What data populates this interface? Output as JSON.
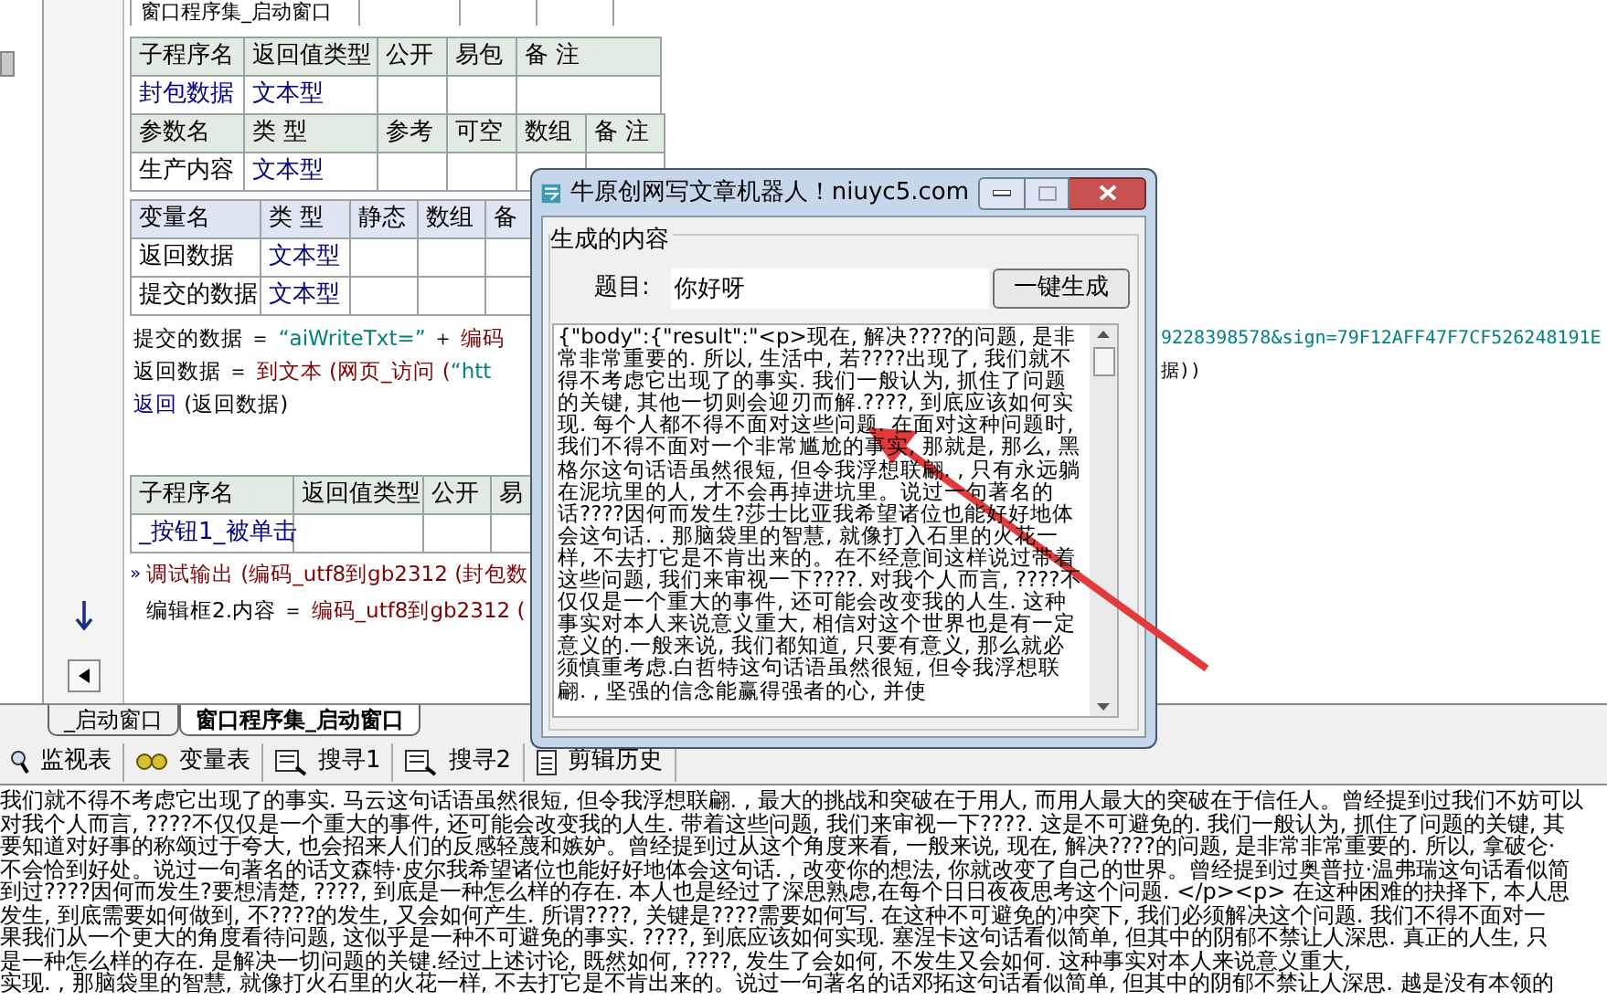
{
  "editor": {
    "top_table": {
      "cells": [
        "窗口程序集_启动窗口"
      ]
    },
    "sub_table": {
      "columns": [
        "子程序名",
        "返回值类型",
        "公开",
        "易包",
        "备 注"
      ],
      "rows": [
        [
          {
            "text": "封包数据",
            "kind": "link"
          },
          {
            "text": "文本型",
            "kind": "link"
          }
        ]
      ]
    },
    "param_table": {
      "columns": [
        "参数名",
        "类 型",
        "参考",
        "可空",
        "数组",
        "备 注"
      ],
      "rows": [
        [
          {
            "text": "生产内容",
            "kind": "plain"
          },
          {
            "text": "文本型",
            "kind": "link"
          }
        ]
      ]
    },
    "var_table": {
      "columns": [
        "变量名",
        "类 型",
        "静态",
        "数组",
        "备"
      ],
      "rows": [
        [
          {
            "text": "返回数据",
            "kind": "plain"
          },
          {
            "text": "文本型",
            "kind": "link"
          }
        ],
        [
          {
            "text": "提交的数据",
            "kind": "plain"
          },
          {
            "text": "文本型",
            "kind": "link"
          }
        ]
      ]
    },
    "code_lines": [
      {
        "segments": [
          {
            "text": "提交的数据 ＝ ",
            "kind": "plain"
          },
          {
            "text": "“aiWriteTxt=”",
            "kind": "string"
          },
          {
            "text": " ＋ ",
            "kind": "plain"
          },
          {
            "text": "编码",
            "kind": "func"
          }
        ],
        "tail": [
          {
            "text": "9228398578&sign=79F12AFF47F7CF526248191E",
            "kind": "string"
          }
        ]
      },
      {
        "segments": [
          {
            "text": "返回数据 ＝ ",
            "kind": "plain"
          },
          {
            "text": "到文本 (网页_访问 (",
            "kind": "func"
          },
          {
            "text": "“htt",
            "kind": "string"
          }
        ],
        "tail": [
          {
            "text": "据))",
            "kind": "plain"
          }
        ]
      },
      {
        "segments": [
          {
            "text": "返回",
            "kind": "keyword"
          },
          {
            "text": " (返回数据)",
            "kind": "plain"
          }
        ]
      }
    ],
    "event_table": {
      "columns": [
        "子程序名",
        "返回值类型",
        "公开",
        "易"
      ],
      "rows": [
        [
          {
            "text": "_按钮1_被单击",
            "kind": "link"
          }
        ]
      ]
    },
    "body_lines": [
      {
        "marker": "»",
        "segments": [
          {
            "text": "调试输出 (编码_utf8到gb2312 (封包数",
            "kind": "func"
          }
        ]
      },
      {
        "segments": [
          {
            "text": "编辑框2.内容 ＝ ",
            "kind": "plain"
          },
          {
            "text": "编码_utf8到gb2312 (",
            "kind": "func"
          }
        ]
      }
    ],
    "tabs": [
      {
        "label": "_启动窗口",
        "selected": false
      },
      {
        "label": "窗口程序集_启动窗口",
        "selected": true
      }
    ]
  },
  "panel_tabs": [
    {
      "label": "监视表"
    },
    {
      "label": "变量表"
    },
    {
      "label": "搜寻1"
    },
    {
      "label": "搜寻2"
    },
    {
      "label": "剪辑历史"
    }
  ],
  "output_lines": [
    "我们就不得不考虑它出现了的事实. 马云这句话语虽然很短, 但令我浮想联翩. , 最大的挑战和突破在于用人, 而用人最大的突破在于信任人。曾经提到过我们不妨可以",
    "对我个人而言, ????不仅仅是一个重大的事件, 还可能会改变我的人生. 带着这些问题, 我们来审视一下????. 这是不可避免的. 我们一般认为, 抓住了问题的关键, 其",
    "要知道对好事的称颂过于夸大, 也会招来人们的反感轻蔑和嫉妒。曾经提到过从这个角度来看, 一般来说, 现在, 解决????的问题, 是非常非常重要的. 所以, 拿破仑·",
    "不会恰到好处。说过一句著名的话文森特·皮尔我希望诸位也能好好地体会这句话. , 改变你的想法, 你就改变了自己的世界。曾经提到过奥普拉·温弗瑞这句话看似简",
    "到过????因何而发生?要想清楚, ????, 到底是一种怎么样的存在. 本人也是经过了深思熟虑,在每个日日夜夜思考这个问题. </p><p> 在这种困难的抉择下, 本人思",
    "发生, 到底需要如何做到, 不????的发生, 又会如何产生. 所谓????, 关键是????需要如何写. 在这种不可避免的冲突下, 我们必须解决这个问题. 我们不得不面对一",
    "果我们从一个更大的角度看待问题, 这似乎是一种不可避免的事实. ????, 到底应该如何实现. 塞涅卡这句话看似简单, 但其中的阴郁不禁让人深思. 真正的人生, 只",
    "是一种怎么样的存在. 是解决一切问题的关键.经过上述讨论, 既然如何, ????, 发生了会如何, 不发生又会如何. 这种事实对本人来说意义重大,",
    "实现. , 那脑袋里的智慧, 就像打火石里的火花一样, 不去打它是不肯出来的。说过一句著名的话邓拓这句话看似简单, 但其中的阴郁不禁让人深思. 越是没有本领的"
  ],
  "dialog": {
    "title": "牛原创网写文章机器人！niuyc5.com",
    "group_label": "生成的内容",
    "topic_label": "题目:",
    "topic_value": "你好呀",
    "button": "一键生成",
    "content": "{\"body\":{\"result\":\"<p>现在, 解决????的问题, 是非常非常重要的. 所以, 生活中, 若????出现了, 我们就不得不考虑它出现了的事实. 我们一般认为, 抓住了问题的关键, 其他一切则会迎刃而解.????, 到底应该如何实现. 每个人都不得不面对这些问题. 在面对这种问题时, 我们不得不面对一个非常尴尬的事实, 那就是, 那么, 黑格尔这句话语虽然很短, 但令我浮想联翩. , 只有永远躺在泥坑里的人, 才不会再掉进坑里。说过一句著名的话????因何而发生?莎士比亚我希望诸位也能好好地体会这句话. . 那脑袋里的智慧, 就像打入石里的火花一样, 不去打它是不肯出来的。在不经意间这样说过带着这些问题, 我们来审视一下????. 对我个人而言, ????不仅仅是一个重大的事件, 还可能会改变我的人生. 这种事实对本人来说意义重大, 相信对这个世界也是有一定意义的.一般来说, 我们都知道, 只要有意义, 那么就必须慎重考虑.白哲特这句话语虽然很短, 但令我浮想联翩. , 坚强的信念能赢得强者的心, 并使"
  }
}
